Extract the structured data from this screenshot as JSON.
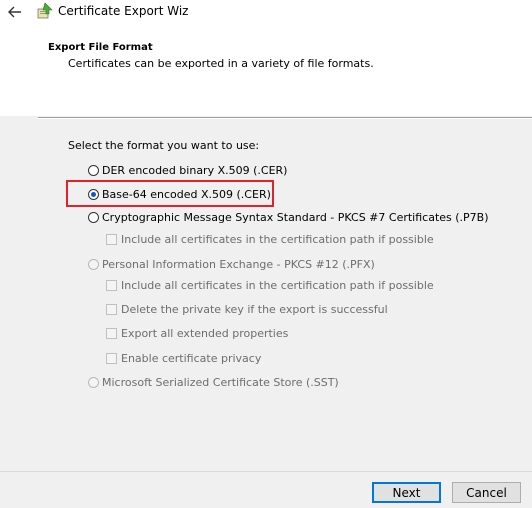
{
  "window": {
    "title": "Certificate Export Wizard"
  },
  "header": {
    "title": "Export File Format",
    "subtitle": "Certificates can be exported in a variety of file formats."
  },
  "prompt": "Select the format you want to use:",
  "options": {
    "der": "DER encoded binary X.509 (.CER)",
    "base64": "Base-64 encoded X.509 (.CER)",
    "pkcs7": "Cryptographic Message Syntax Standard - PKCS #7 Certificates (.P7B)",
    "pkcs7_include_all": "Include all certificates in the certification path if possible",
    "pfx": "Personal Information Exchange - PKCS #12 (.PFX)",
    "pfx_include_all": "Include all certificates in the certification path if possible",
    "pfx_delete_key": "Delete the private key if the export is successful",
    "pfx_export_props": "Export all extended properties",
    "pfx_privacy": "Enable certificate privacy",
    "sst": "Microsoft Serialized Certificate Store (.SST)"
  },
  "selected": "base64",
  "highlight_color": "#e0232b",
  "buttons": {
    "next": "Next",
    "cancel": "Cancel"
  }
}
